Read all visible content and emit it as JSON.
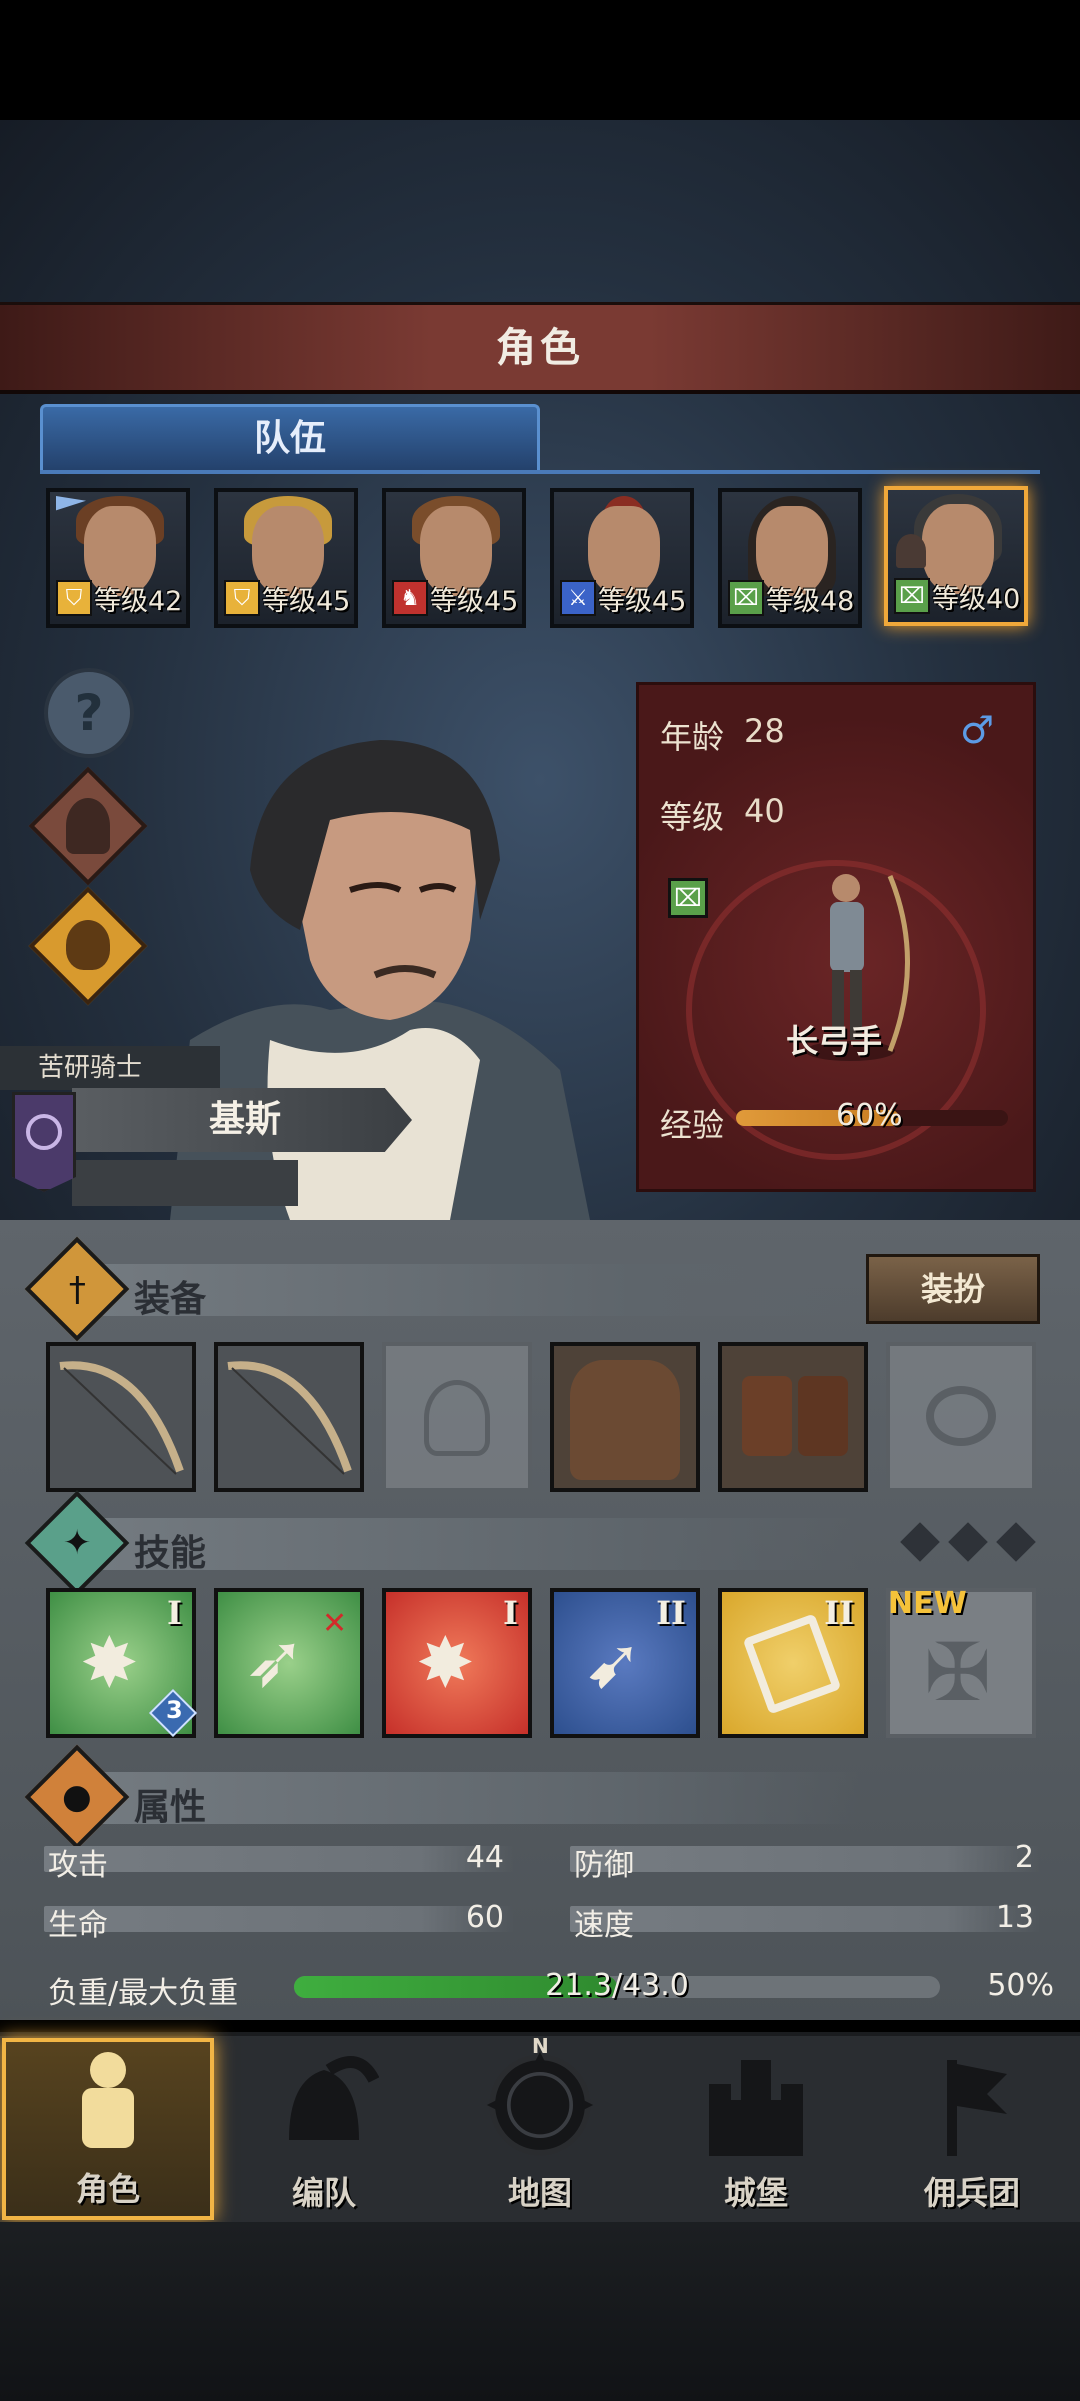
{
  "header": {
    "title": "角色"
  },
  "tabs": {
    "team": "队伍"
  },
  "party": [
    {
      "level_text": "等级42",
      "class_icon": "shield-icon",
      "class_color": "#e8b23a",
      "hair": "#6b3f24"
    },
    {
      "level_text": "等级45",
      "class_icon": "shield-icon",
      "class_color": "#e8b23a",
      "hair": "#c79a3c"
    },
    {
      "level_text": "等级45",
      "class_icon": "horse-icon",
      "class_color": "#c0322e",
      "hair": "#7a4d2b"
    },
    {
      "level_text": "等级45",
      "class_icon": "sword-icon",
      "class_color": "#3b63c8",
      "hair": "#8a2d22"
    },
    {
      "level_text": "等级48",
      "class_icon": "bow-icon",
      "class_color": "#5aa04a",
      "hair": "#2a2421"
    },
    {
      "level_text": "等级40",
      "class_icon": "bow-icon",
      "class_color": "#5aa04a",
      "hair": "#3a3a3a"
    }
  ],
  "character": {
    "age_label": "年龄",
    "age": "28",
    "level_label": "等级",
    "level": "40",
    "gender_icon": "male-icon",
    "class_name": "长弓手",
    "exp_label": "经验",
    "exp_percent": "60%",
    "exp_fraction": 0.6,
    "title": "苦研骑士",
    "name": "基斯"
  },
  "equipment": {
    "title": "装备",
    "dress_button": "装扮"
  },
  "skills": {
    "title": "技能",
    "new_badge": "NEW",
    "items": [
      {
        "rank": "I",
        "color": "#3f8f45",
        "badge": "3"
      },
      {
        "rank": "",
        "color": "#3f8f45"
      },
      {
        "rank": "I",
        "color": "#c6302a"
      },
      {
        "rank": "II",
        "color": "#2d4f8e"
      },
      {
        "rank": "II",
        "color": "#d9a72b"
      }
    ]
  },
  "attributes": {
    "title": "属性",
    "attack_label": "攻击",
    "attack": "44",
    "defense_label": "防御",
    "defense": "2",
    "hp_label": "生命",
    "hp": "60",
    "speed_label": "速度",
    "speed": "13",
    "load_label": "负重/最大负重",
    "load_text": "21.3/43.0",
    "load_percent": "50%",
    "load_fraction": 0.5
  },
  "nav": [
    {
      "label": "角色"
    },
    {
      "label": "编队"
    },
    {
      "label": "地图",
      "compass_n": "N"
    },
    {
      "label": "城堡"
    },
    {
      "label": "佣兵团"
    }
  ]
}
